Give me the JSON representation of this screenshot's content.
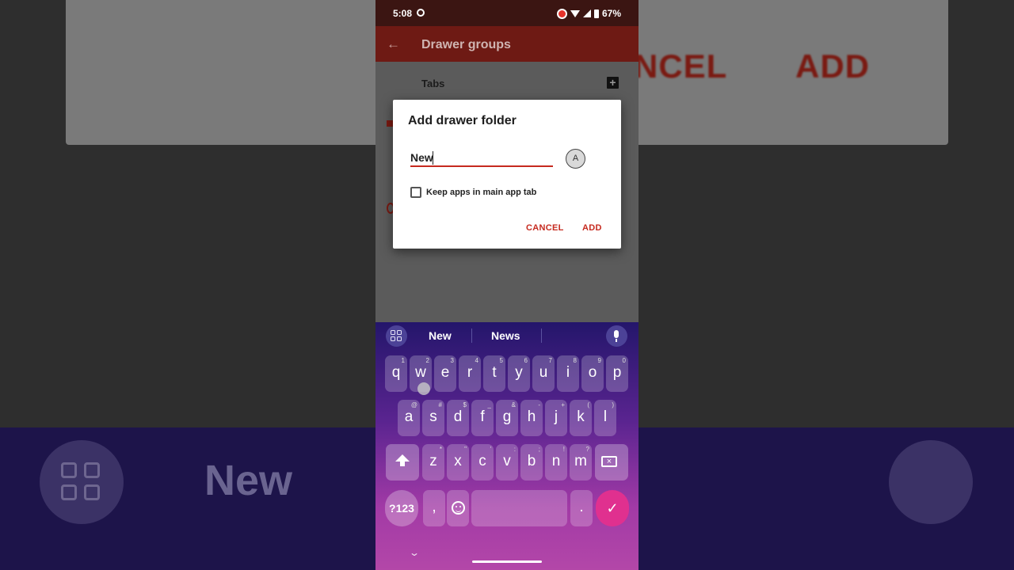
{
  "background": {
    "cancel_text": "NCEL",
    "add_text": "ADD",
    "suggestion_text": "New"
  },
  "status_bar": {
    "time": "5:08",
    "battery": "67%"
  },
  "app_bar": {
    "back_icon": "arrow-back-icon",
    "title": "Drawer groups"
  },
  "content": {
    "tabs_label": "Tabs",
    "add_icon": "plus-box-icon"
  },
  "dialog": {
    "title": "Add drawer folder",
    "input_value": "New",
    "avatar_letter": "A",
    "checkbox_label": "Keep apps in main app tab",
    "checkbox_checked": false,
    "cancel_label": "CANCEL",
    "add_label": "ADD"
  },
  "keyboard": {
    "suggestions": [
      "New",
      "News"
    ],
    "row1": [
      {
        "k": "q",
        "h": "1"
      },
      {
        "k": "w",
        "h": "2"
      },
      {
        "k": "e",
        "h": "3"
      },
      {
        "k": "r",
        "h": "4"
      },
      {
        "k": "t",
        "h": "5"
      },
      {
        "k": "y",
        "h": "6"
      },
      {
        "k": "u",
        "h": "7"
      },
      {
        "k": "i",
        "h": "8"
      },
      {
        "k": "o",
        "h": "9"
      },
      {
        "k": "p",
        "h": "0"
      }
    ],
    "row2": [
      {
        "k": "a",
        "h": "@"
      },
      {
        "k": "s",
        "h": "#"
      },
      {
        "k": "d",
        "h": "$"
      },
      {
        "k": "f",
        "h": "_"
      },
      {
        "k": "g",
        "h": "&"
      },
      {
        "k": "h",
        "h": "-"
      },
      {
        "k": "j",
        "h": "+"
      },
      {
        "k": "k",
        "h": "("
      },
      {
        "k": "l",
        "h": ")"
      }
    ],
    "row3": [
      {
        "k": "z",
        "h": "*"
      },
      {
        "k": "x",
        "h": "\""
      },
      {
        "k": "c",
        "h": "'"
      },
      {
        "k": "v",
        "h": ":"
      },
      {
        "k": "b",
        "h": ";"
      },
      {
        "k": "n",
        "h": "!"
      },
      {
        "k": "m",
        "h": "?"
      }
    ],
    "symbols_label": "?123",
    "comma_label": ",",
    "period_label": ".",
    "enter_icon": "check-icon",
    "accent_color": "#e0308f"
  },
  "colors": {
    "app_bar": "#6e1a14",
    "accent": "#c62a1f"
  }
}
